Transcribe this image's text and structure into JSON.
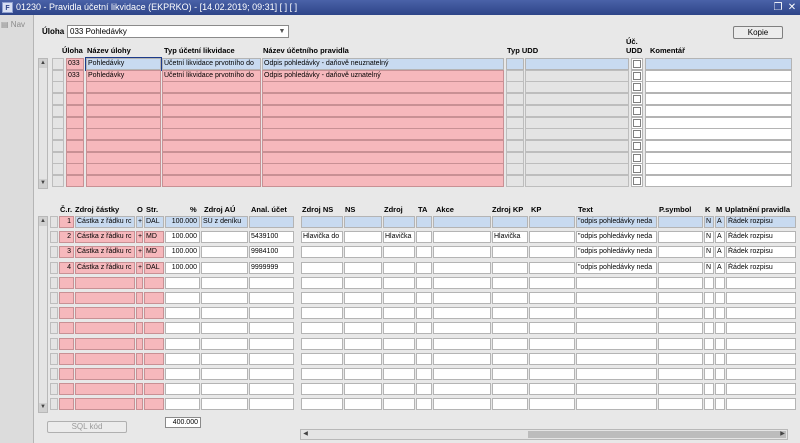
{
  "window": {
    "title": "01230 - Pravidla účetní likvidace (EKPRKO) - [14.02.2019; 09:31] [ ] [ ]",
    "app_icon": "F"
  },
  "side": {
    "nav_label": "Nav"
  },
  "header": {
    "uloha_label": "Úloha",
    "uloha_value": "033 Pohledávky",
    "kopie_button": "Kopie"
  },
  "top_grid": {
    "columns": {
      "uloha": "Úloha",
      "nazev_ulohy": "Název úlohy",
      "typ_ucetni_likvidace": "Typ účetní likvidace",
      "nazev_ucetniho_pravidla": "Název účetního pravidla",
      "typ_udd": "Typ UDD",
      "uc_udd_line1": "Úč.",
      "uc_udd_line2": "UDD",
      "komentar": "Komentář"
    },
    "rows": [
      {
        "uloha": "033",
        "nazev": "Pohledávky",
        "typ": "Účetní likvidace prvotního do",
        "pravidlo": "Odpis pohledávky - daňově neuznatelný"
      },
      {
        "uloha": "033",
        "nazev": "Pohledávky",
        "typ": "Účetní likvidace prvotního do",
        "pravidlo": "Odpis pohledávky - daňově uznatelný"
      }
    ],
    "empty_rows": 9
  },
  "bottom_grid": {
    "columns": {
      "cr": "Č.r.",
      "zdroj_castky": "Zdroj částky",
      "o": "O",
      "str": "Str.",
      "pct": "%",
      "zdroj_au": "Zdroj AÚ",
      "anal_ucet": "Anal. účet",
      "zdroj_ns": "Zdroj NS",
      "ns": "NS",
      "zdroj": "Zdroj",
      "ta": "TA",
      "akce": "Akce",
      "zdroj_kp": "Zdroj KP",
      "kp": "KP",
      "text": "Text",
      "psymbol": "P.symbol",
      "k": "K",
      "m": "M",
      "uplatneni": "Uplatnění pravidla"
    },
    "rows": [
      {
        "cr": "1",
        "zdroj_castky": "Částka z řádku rc",
        "o": "+",
        "str": "DAL",
        "pct": "100.000",
        "zdroj_au": "SÚ z deníku",
        "anal": "",
        "zdroj_ns": "",
        "zdroj": "",
        "zdroj_kp": "",
        "text": "\"odpis pohledávky neda",
        "k": "N",
        "m": "A",
        "uplatneni": "Řádek rozpisu"
      },
      {
        "cr": "2",
        "zdroj_castky": "Částka z řádku rc",
        "o": "+",
        "str": "MD",
        "pct": "100.000",
        "zdroj_au": "",
        "anal": "5439100",
        "zdroj_ns": "Hlavička do",
        "zdroj": "Hlavička",
        "zdroj_kp": "Hlavička",
        "text": "\"odpis pohledávky neda",
        "k": "N",
        "m": "A",
        "uplatneni": "Řádek rozpisu"
      },
      {
        "cr": "3",
        "zdroj_castky": "Částka z řádku rc",
        "o": "+",
        "str": "MD",
        "pct": "100.000",
        "zdroj_au": "",
        "anal": "9984100",
        "zdroj_ns": "",
        "zdroj": "",
        "zdroj_kp": "",
        "text": "\"odpis pohledávky neda",
        "k": "N",
        "m": "A",
        "uplatneni": "Řádek rozpisu"
      },
      {
        "cr": "4",
        "zdroj_castky": "Částka z řádku rc",
        "o": "+",
        "str": "DAL",
        "pct": "100.000",
        "zdroj_au": "",
        "anal": "9999999",
        "zdroj_ns": "",
        "zdroj": "",
        "zdroj_kp": "",
        "text": "\"odpis pohledávky neda",
        "k": "N",
        "m": "A",
        "uplatneni": "Řádek rozpisu"
      }
    ],
    "empty_rows": 9,
    "total": "400.000"
  },
  "footer": {
    "sql_button": "SQL kód"
  }
}
